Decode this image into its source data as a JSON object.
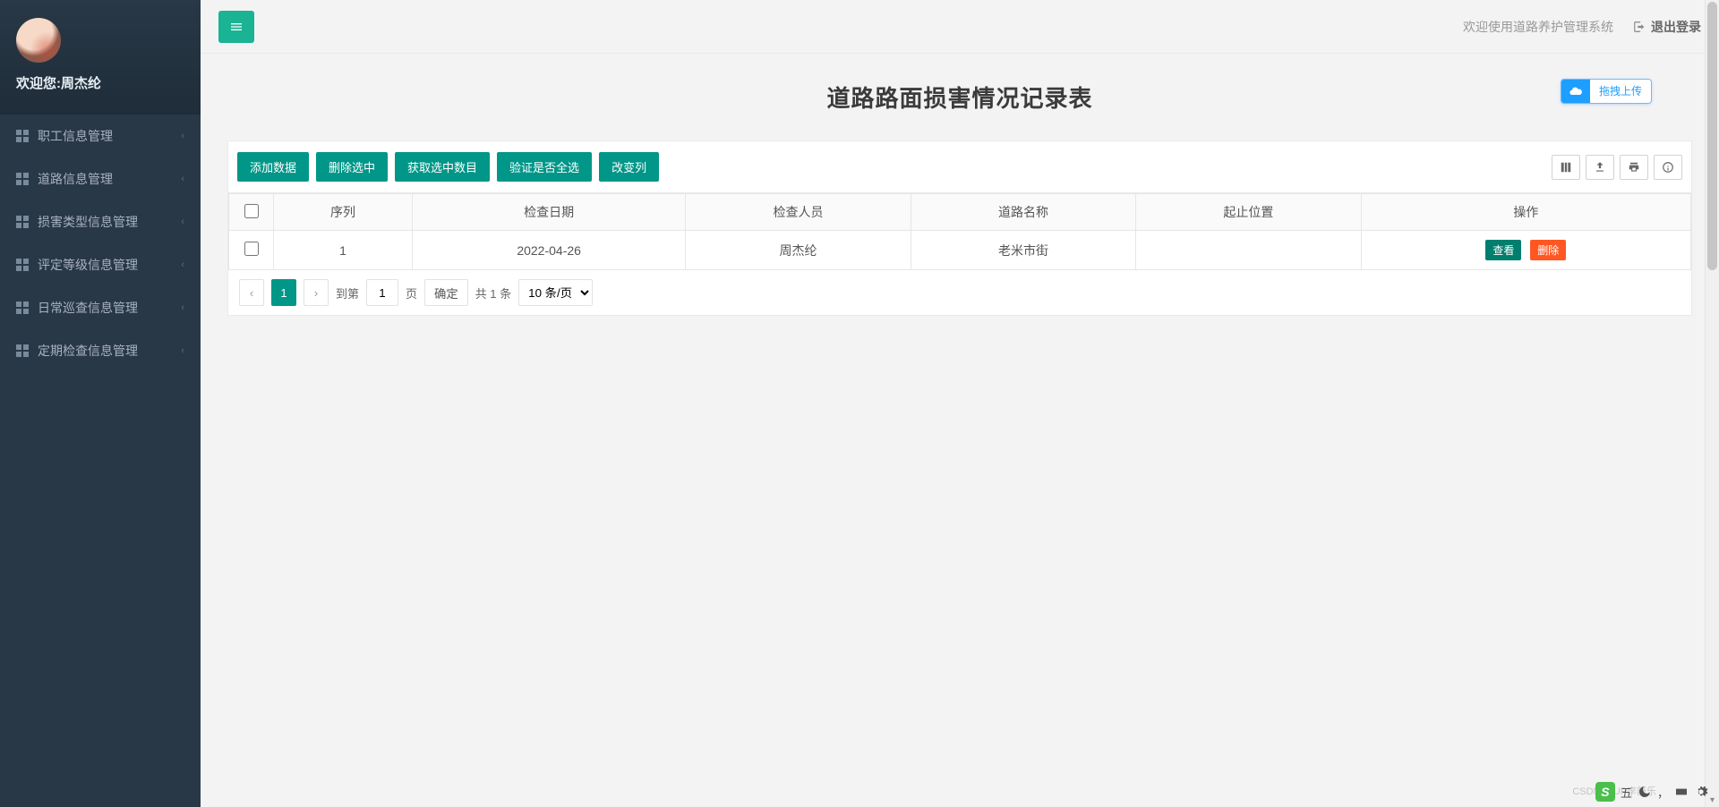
{
  "user": {
    "welcome_prefix": "欢迎您:",
    "name": "周杰纶"
  },
  "sidebar": {
    "items": [
      {
        "label": "职工信息管理"
      },
      {
        "label": "道路信息管理"
      },
      {
        "label": "损害类型信息管理"
      },
      {
        "label": "评定等级信息管理"
      },
      {
        "label": "日常巡查信息管理"
      },
      {
        "label": "定期检查信息管理"
      }
    ]
  },
  "topbar": {
    "welcome_system": "欢迎使用道路养护管理系统",
    "logout": "退出登录"
  },
  "page": {
    "title": "道路路面损害情况记录表",
    "upload_label": "拖拽上传"
  },
  "toolbar": {
    "buttons": [
      {
        "label": "添加数据"
      },
      {
        "label": "删除选中"
      },
      {
        "label": "获取选中数目"
      },
      {
        "label": "验证是否全选"
      },
      {
        "label": "改变列"
      }
    ]
  },
  "table": {
    "headers": [
      "序列",
      "检查日期",
      "检查人员",
      "道路名称",
      "起止位置",
      "操作"
    ],
    "rows": [
      {
        "seq": "1",
        "date": "2022-04-26",
        "inspector": "周杰纶",
        "road": "老米市街",
        "range": "",
        "actions": {
          "view": "查看",
          "delete": "删除"
        }
      }
    ]
  },
  "pager": {
    "current": "1",
    "goto_label": "到第",
    "page_unit": "页",
    "confirm": "确定",
    "total": "共 1 条",
    "per_page": "10 条/页",
    "goto_value": "1"
  },
  "ime": {
    "label": "五",
    "watermark": "CSDN @UP李舒乐"
  }
}
